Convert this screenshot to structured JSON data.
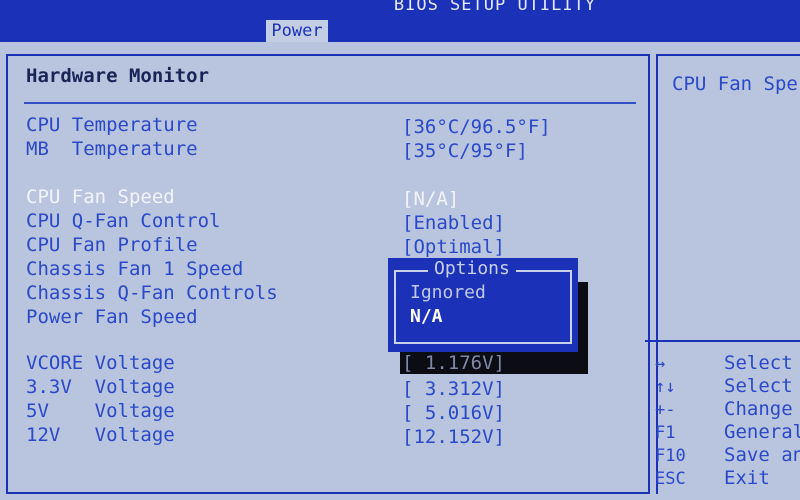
{
  "header": {
    "title": "BIOS SETUP UTILITY",
    "active_tab": "Power"
  },
  "main": {
    "heading": "Hardware Monitor",
    "rows": [
      {
        "label": "CPU Temperature",
        "value": "[36°C/96.5°F]"
      },
      {
        "label": "MB  Temperature",
        "value": "[35°C/95°F]"
      },
      {
        "label": "CPU Fan Speed",
        "value": "[N/A]"
      },
      {
        "label": "CPU Q-Fan Control",
        "value": "[Enabled]"
      },
      {
        "label": "CPU Fan Profile",
        "value": "[Optimal]"
      },
      {
        "label": "Chassis Fan 1 Speed",
        "value": ""
      },
      {
        "label": "Chassis Q-Fan Controls",
        "value": ""
      },
      {
        "label": "Power Fan Speed",
        "value": ""
      },
      {
        "label": "VCORE Voltage",
        "value": "[ 1.176V]"
      },
      {
        "label": "3.3V  Voltage",
        "value": "[ 3.312V]"
      },
      {
        "label": "5V    Voltage",
        "value": "[ 5.016V]"
      },
      {
        "label": "12V   Voltage",
        "value": "[12.152V]"
      }
    ]
  },
  "popup": {
    "title": "Options",
    "options": [
      "Ignored",
      "N/A"
    ],
    "selected": "N/A"
  },
  "help": {
    "text": "CPU Fan Spe",
    "keys": [
      {
        "key": "↔",
        "desc": "Select"
      },
      {
        "key": "↑↓",
        "desc": "Select"
      },
      {
        "key": "+-",
        "desc": "Change"
      },
      {
        "key": "F1",
        "desc": "General"
      },
      {
        "key": "F10",
        "desc": "Save an"
      },
      {
        "key": "ESC",
        "desc": "Exit"
      }
    ]
  },
  "colors": {
    "bar_blue": "#1a31b8",
    "background": "#b9c5de",
    "item_text": "#2a48c8",
    "highlight_text": "#f2f4fa"
  }
}
